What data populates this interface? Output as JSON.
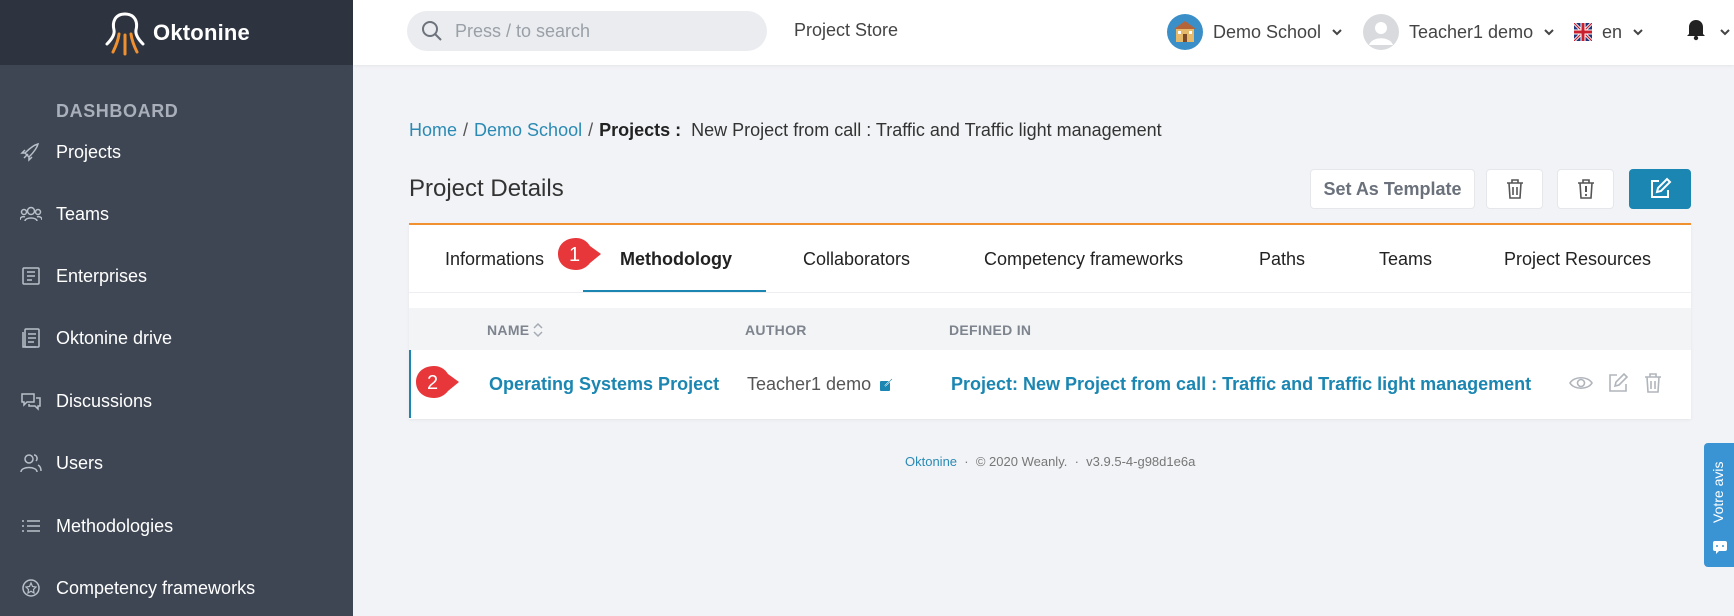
{
  "app": {
    "logo_text": "Oktonine"
  },
  "sidebar": {
    "section_title": "DASHBOARD",
    "items": [
      {
        "label": "Projects",
        "icon": "rocket-icon"
      },
      {
        "label": "Teams",
        "icon": "team-icon"
      },
      {
        "label": "Enterprises",
        "icon": "enterprise-icon"
      },
      {
        "label": "Oktonine drive",
        "icon": "drive-icon"
      },
      {
        "label": "Discussions",
        "icon": "discussions-icon"
      },
      {
        "label": "Users",
        "icon": "users-icon"
      },
      {
        "label": "Methodologies",
        "icon": "list-icon"
      },
      {
        "label": "Competency frameworks",
        "icon": "badge-icon"
      }
    ]
  },
  "header": {
    "search_placeholder": "Press / to search",
    "store_link": "Project Store",
    "school": "Demo School",
    "user": "Teacher1 demo",
    "language": "en"
  },
  "breadcrumb": {
    "home": "Home",
    "separator": "/",
    "school": "Demo School",
    "section": "Projects :",
    "current": "New Project from call : Traffic and Traffic light management"
  },
  "page": {
    "title": "Project Details",
    "set_template_label": "Set As Template"
  },
  "tabs": [
    "Informations",
    "Methodology",
    "Collaborators",
    "Competency frameworks",
    "Paths",
    "Teams",
    "Project Resources"
  ],
  "active_tab": "Methodology",
  "table": {
    "headers": {
      "name": "NAME",
      "author": "AUTHOR",
      "defined_in": "DEFINED IN"
    },
    "rows": [
      {
        "name": "Operating Systems Project",
        "author": "Teacher1 demo",
        "defined_in": "Project: New Project from call : Traffic and Traffic light management"
      }
    ]
  },
  "markers": [
    "1",
    "2"
  ],
  "footer": {
    "brand": "Oktonine",
    "dot": "·",
    "copyright": "© 2020 Weanly.",
    "version": "v3.9.5-4-g98d1e6a"
  },
  "feedback": {
    "label": "Votre avis"
  },
  "colors": {
    "accent": "#1a86b1",
    "sidebar": "#3e4653",
    "marker": "#e8373a",
    "tab_border": "#f0902f"
  }
}
